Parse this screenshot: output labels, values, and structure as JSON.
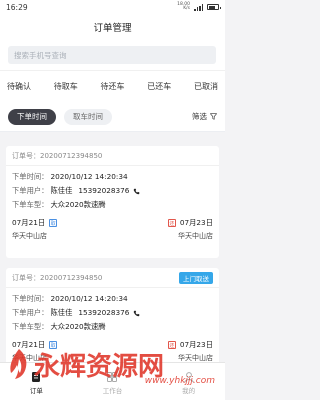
{
  "status_bar": {
    "time": "16:29",
    "net_speed": "18.00",
    "net_unit": "K/s"
  },
  "header": {
    "title": "订单管理"
  },
  "search": {
    "placeholder": "搜索手机号查询"
  },
  "status_tabs": [
    "待确认",
    "待取车",
    "待还车",
    "已还车",
    "已取消"
  ],
  "sort": {
    "options": [
      "下单时间",
      "取车时间"
    ],
    "active_index": 0,
    "filter_label": "筛选"
  },
  "labels": {
    "order_no": "订单号：",
    "order_time": "下单时间：",
    "order_user": "下单用户：",
    "order_car": "下单车型："
  },
  "orders": [
    {
      "order_no": "20200712394850",
      "tag": "",
      "order_time": "2020/10/12  14:20:34",
      "user_name": "陈佳佳",
      "phone": "15392028376",
      "car": "大众2020款速腾",
      "pickup_date": "07月21日",
      "pickup_badge": "取",
      "return_date": "07月23日",
      "return_badge": "还",
      "pickup_store": "华天中山店",
      "return_store": "华天中山店"
    },
    {
      "order_no": "20200712394850",
      "tag": "上门取送",
      "order_time": "2020/10/12  14:20:34",
      "user_name": "陈佳佳",
      "phone": "15392028376",
      "car": "大众2020款速腾",
      "pickup_date": "07月21日",
      "pickup_badge": "取",
      "return_date": "07月23日",
      "return_badge": "还",
      "pickup_store": "华天中山店",
      "return_store": "华天中山店"
    }
  ],
  "tabbar": {
    "items": [
      "订单",
      "工作台",
      "我的"
    ],
    "active_index": 0
  },
  "watermark": {
    "text": "永辉资源网",
    "url": "www.yhkjjj.com"
  },
  "colors": {
    "accent": "#35a7e9",
    "dark_button": "#3f4048",
    "watermark": "#e13a2e"
  }
}
